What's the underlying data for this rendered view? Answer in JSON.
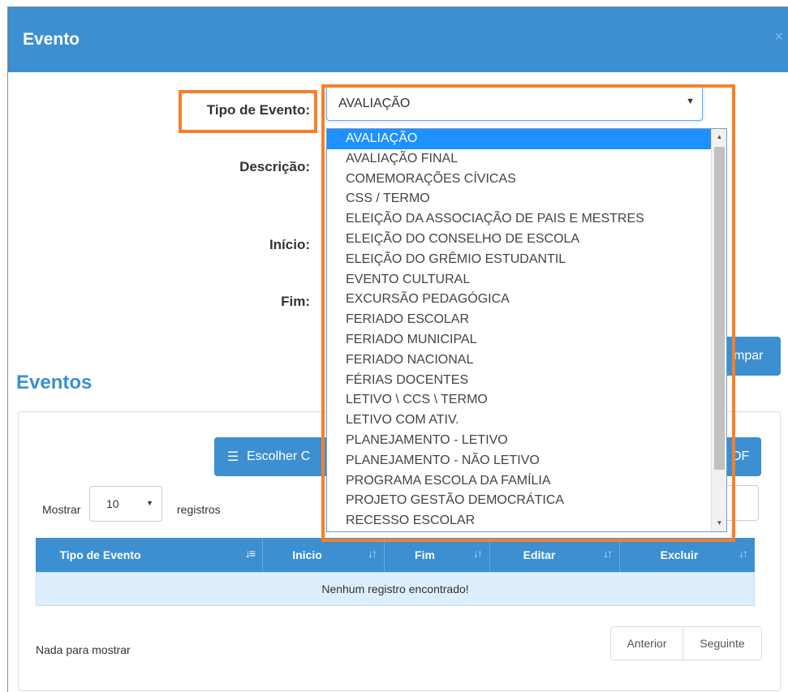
{
  "modal": {
    "title": "Evento",
    "close_symbol": "×"
  },
  "form": {
    "tipo_label": "Tipo de Evento:",
    "descricao_label": "Descrição:",
    "inicio_label": "Início:",
    "fim_label": "Fim:",
    "tipo_value": "AVALIAÇÃO",
    "clear_button_partial": "mpar"
  },
  "dropdown": {
    "options": [
      "AVALIAÇÃO",
      "AVALIAÇÃO FINAL",
      "COMEMORAÇÕES CÍVICAS",
      "CSS / TERMO",
      "ELEIÇÃO DA ASSOCIAÇÃO DE PAIS E MESTRES",
      "ELEIÇÃO DO CONSELHO DE ESCOLA",
      "ELEIÇÃO DO GRÊMIO ESTUDANTIL",
      "EVENTO CULTURAL",
      "EXCURSÃO PEDAGÓGICA",
      "FERIADO ESCOLAR",
      "FERIADO MUNICIPAL",
      "FERIADO NACIONAL",
      "FÉRIAS DOCENTES",
      "LETIVO \\ CCS \\ TERMO",
      "LETIVO COM ATIV.",
      "PLANEJAMENTO - LETIVO",
      "PLANEJAMENTO - NÃO LETIVO",
      "PROGRAMA ESCOLA DA FAMÍLIA",
      "PROJETO GESTÃO DEMOCRÁTICA",
      "RECESSO ESCOLAR"
    ],
    "selected_index": 0
  },
  "eventos": {
    "title": "Eventos",
    "choose_columns_partial": "Escolher C",
    "pdf_partial": "DF",
    "length_prefix": "Mostrar",
    "length_value": "10",
    "length_suffix": "registros",
    "columns": [
      {
        "label": "Tipo de Evento",
        "sort": "↓≡",
        "active": true
      },
      {
        "label": "Inicio",
        "sort": "↓↑",
        "active": false
      },
      {
        "label": "Fim",
        "sort": "↓↑",
        "active": false
      },
      {
        "label": "Editar",
        "sort": "↓↑",
        "active": false
      },
      {
        "label": "Excluir",
        "sort": "↓↑",
        "active": false
      }
    ],
    "empty_message": "Nenhum registro encontrado!",
    "info": "Nada para mostrar",
    "prev_label": "Anterior",
    "next_label": "Seguinte"
  },
  "colors": {
    "accent": "#3c8fd0",
    "highlight": "#f5802b",
    "selected_option": "#1e90ff",
    "empty_row": "#ddeefc"
  },
  "icons": {
    "list": "list-icon",
    "close": "close-icon",
    "sort": "sort-icon",
    "dropdown_arrow": "caret-down-icon"
  }
}
